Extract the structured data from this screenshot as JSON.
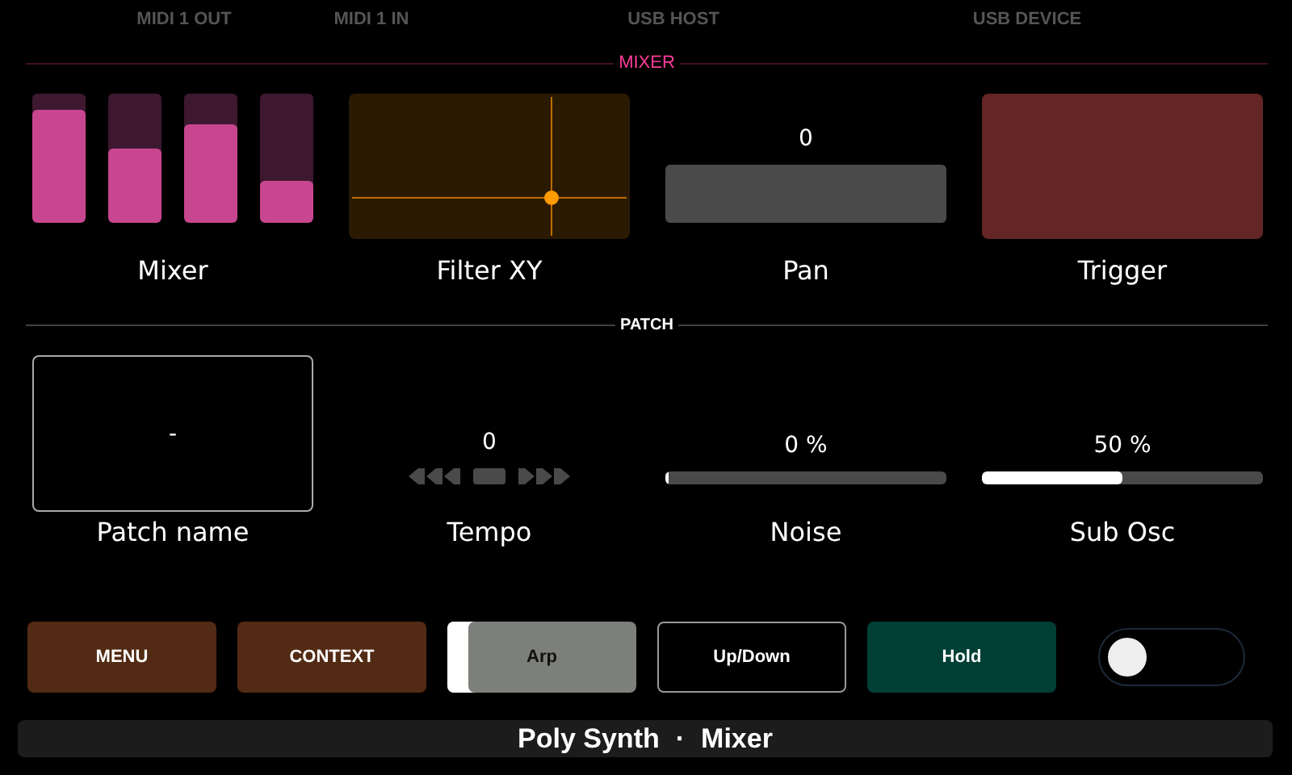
{
  "status_bar": {
    "items": [
      "MIDI 1 OUT",
      "MIDI 1 IN",
      "USB HOST",
      "USB DEVICE"
    ]
  },
  "sections": [
    {
      "title": "MIXER",
      "color": "#ff3d9a",
      "widgets": [
        {
          "kind": "faders",
          "label": "Mixer",
          "faders": [
            {
              "level": 0.875
            },
            {
              "level": 0.575
            },
            {
              "level": 0.76
            },
            {
              "level": 0.325
            }
          ]
        },
        {
          "kind": "xy_pad",
          "label": "Filter XY",
          "axis_x": {
            "level": 0.72
          },
          "axis_y": {
            "level": 0.29
          }
        },
        {
          "kind": "bipolar",
          "label": "Pan",
          "value": "0",
          "level": 0.5
        },
        {
          "kind": "pad",
          "label": "Trigger"
        }
      ]
    },
    {
      "title": "PATCH",
      "color": "#ffffff",
      "widgets": [
        {
          "kind": "name_box",
          "label": "Patch name",
          "value": "-"
        },
        {
          "kind": "stepper",
          "label": "Tempo",
          "value": "0"
        },
        {
          "kind": "slider",
          "label": "Noise",
          "value": "0 %",
          "level": 0
        },
        {
          "kind": "slider",
          "label": "Sub Osc",
          "value": "50 %",
          "level": 0.5
        }
      ]
    }
  ],
  "buttons": [
    {
      "kind": "fill",
      "label": "MENU",
      "color": "#532a13"
    },
    {
      "kind": "fill",
      "label": "CONTEXT",
      "color": "#532a13"
    },
    {
      "kind": "indicator",
      "label": "Arp",
      "color": "#7d7f7b",
      "on": true
    },
    {
      "kind": "outline",
      "label": "Up/Down"
    },
    {
      "kind": "fill",
      "label": "Hold",
      "color": "#003f35"
    }
  ],
  "toggle": {
    "on": false
  },
  "footer": {
    "parts": [
      "Poly Synth",
      "·",
      "Mixer"
    ]
  }
}
